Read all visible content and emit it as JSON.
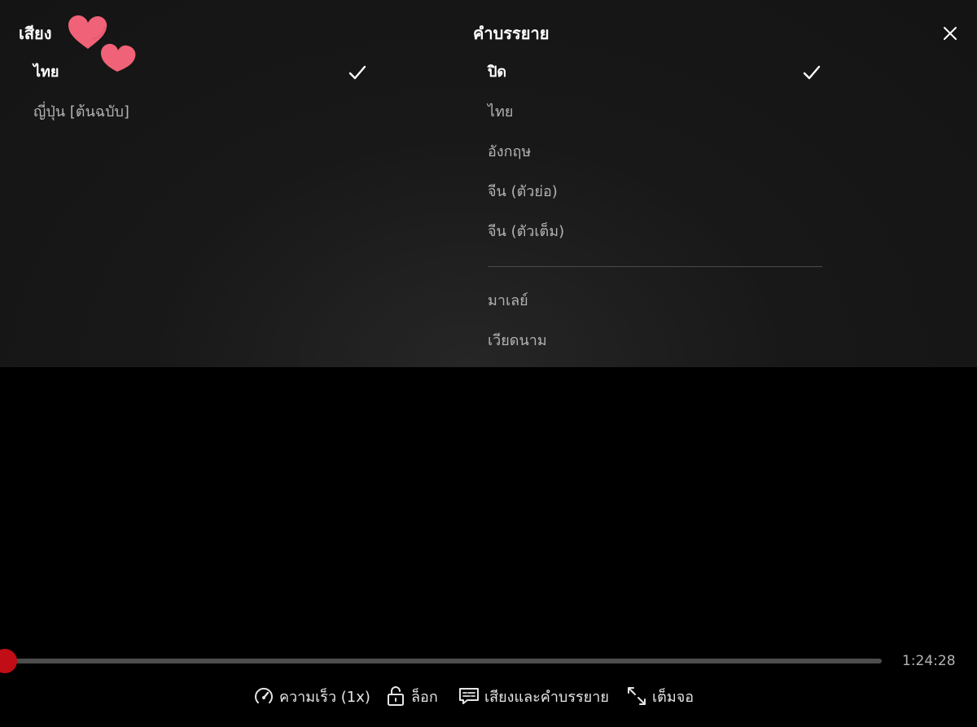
{
  "audio": {
    "heading": "เสียง",
    "options": [
      "ไทย",
      "ญี่ปุ่น [ต้นฉบับ]"
    ],
    "selected": "ไทย"
  },
  "subtitles": {
    "heading": "คำบรรยาย",
    "primary_options": [
      "ปิด",
      "ไทย",
      "อังกฤษ",
      "จีน (ตัวย่อ)",
      "จีน (ตัวเต็ม)"
    ],
    "more_options": [
      "มาเลย์",
      "เวียดนาม"
    ],
    "selected": "ปิด"
  },
  "icons": {
    "close": "close-icon",
    "check": "checkmark-icon",
    "speed": "speedometer-icon",
    "lock": "unlock-icon",
    "subtitles": "subtitles-icon",
    "fullscreen": "expand-icon",
    "decoration": "hearts-sticker"
  },
  "player": {
    "time_remaining": "1:24:28",
    "progress": 0.005,
    "speed_label": "ความเร็ว (1x)",
    "lock_label": "ล็อก",
    "audio_subtitles_label": "เสียงและคำบรรยาย",
    "fullscreen_label": "เต็มจอ"
  },
  "colors": {
    "accent": "#e50914",
    "panel_bg": "#181818",
    "text_selected": "#ffffff",
    "text_muted": "#b3b3b3",
    "heart": "#f06277"
  }
}
